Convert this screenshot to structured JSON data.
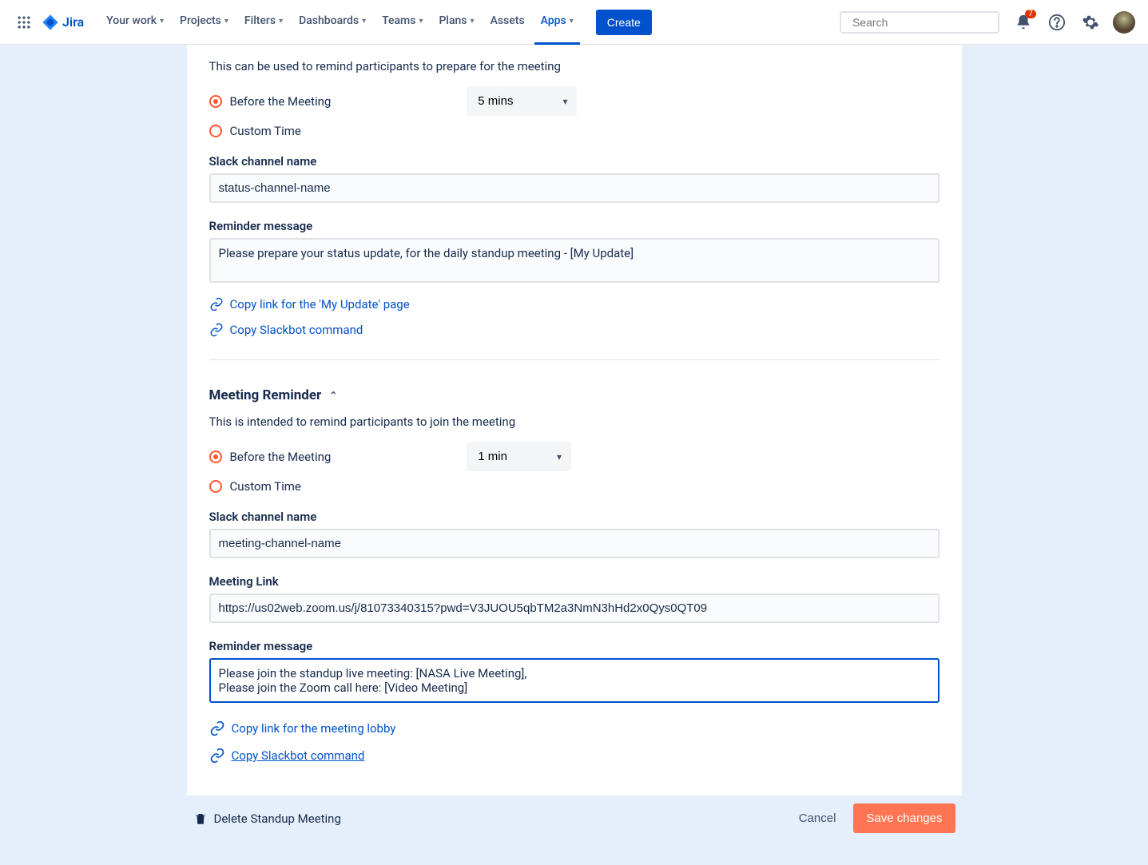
{
  "nav": {
    "logo": "Jira",
    "items": [
      "Your work",
      "Projects",
      "Filters",
      "Dashboards",
      "Teams",
      "Plans",
      "Assets",
      "Apps"
    ],
    "active_index": 7,
    "create": "Create",
    "search_placeholder": "Search",
    "notification_count": "7"
  },
  "prep": {
    "help": "This can be used to remind participants to prepare for the meeting",
    "radio_before": "Before the Meeting",
    "radio_custom": "Custom Time",
    "time_select": "5 mins",
    "slack_label": "Slack channel name",
    "slack_value": "status-channel-name",
    "msg_label": "Reminder message",
    "msg_value": "Please prepare your status update, for the daily standup meeting - [My Update]",
    "link_myupdate": "Copy link for the 'My Update' page",
    "link_slackbot": "Copy Slackbot command"
  },
  "meeting": {
    "title": "Meeting Reminder",
    "help": "This is intended to remind participants to join the meeting",
    "radio_before": "Before the Meeting",
    "radio_custom": "Custom Time",
    "time_select": "1 min",
    "slack_label": "Slack channel name",
    "slack_value": "meeting-channel-name",
    "link_label": "Meeting Link",
    "link_value": "https://us02web.zoom.us/j/81073340315?pwd=V3JUOU5qbTM2a3NmN3hHd2x0Qys0QT09",
    "msg_label": "Reminder message",
    "msg_value": "Please join the standup live meeting: [NASA Live Meeting],\nPlease join the Zoom call here: [Video Meeting]",
    "link_lobby": " Copy link for the meeting lobby",
    "link_slackbot": " Copy Slackbot command"
  },
  "footer": {
    "delete": "Delete Standup Meeting",
    "cancel": "Cancel",
    "save": "Save changes"
  }
}
